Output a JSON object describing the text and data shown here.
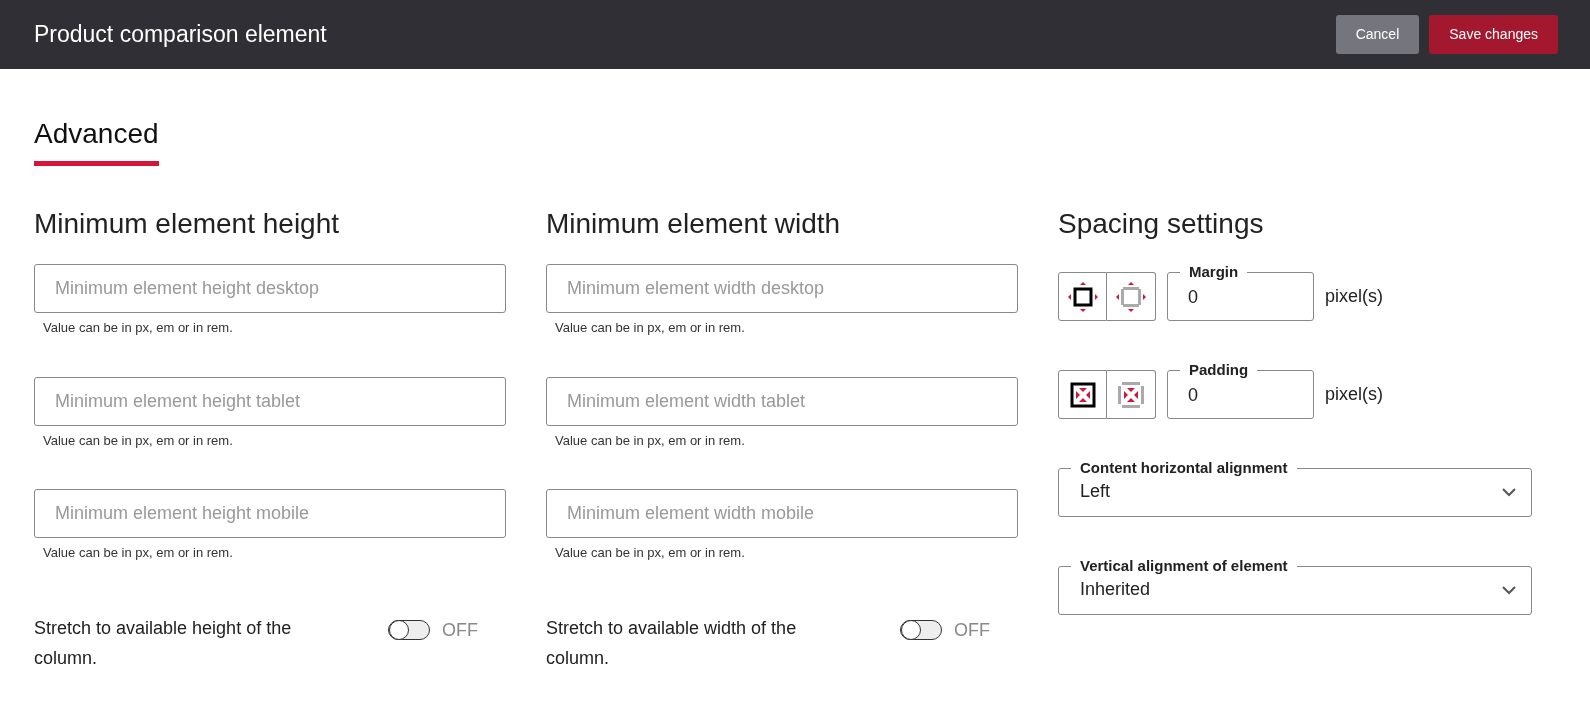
{
  "header": {
    "title": "Product comparison element",
    "buttons": [
      {
        "label": "Cancel",
        "kind": "secondary"
      },
      {
        "label": "Save changes",
        "kind": "primary"
      }
    ]
  },
  "tabs": [
    {
      "label": "Advanced",
      "selected": true
    }
  ],
  "columns": [
    {
      "heading": "Minimum element height",
      "fields": [
        {
          "placeholder": "Minimum element height desktop",
          "hint": "Value can be in px, em or in rem."
        },
        {
          "placeholder": "Minimum element height tablet",
          "hint": "Value can be in px, em or in rem."
        },
        {
          "placeholder": "Minimum element height mobile",
          "hint": "Value can be in px, em or in rem."
        }
      ],
      "toggle": {
        "label": "Stretch to available height of the column.",
        "on": false,
        "state_text": "OFF"
      }
    },
    {
      "heading": "Minimum element width",
      "fields": [
        {
          "placeholder": "Minimum element width desktop",
          "hint": "Value can be in px, em or in rem."
        },
        {
          "placeholder": "Minimum element width tablet",
          "hint": "Value can be in px, em or in rem."
        },
        {
          "placeholder": "Minimum element width mobile",
          "hint": "Value can be in px, em or in rem."
        }
      ],
      "toggle": {
        "label": "Stretch to available width of the column.",
        "on": false,
        "state_text": "OFF"
      }
    }
  ],
  "spacing": {
    "heading": "Spacing settings",
    "rows": [
      {
        "kind": "margin",
        "label": "Margin",
        "value": "0",
        "unit": "pixel(s)",
        "modes": [
          {
            "selected": true
          },
          {
            "selected": false
          }
        ]
      },
      {
        "kind": "padding",
        "label": "Padding",
        "value": "0",
        "unit": "pixel(s)",
        "modes": [
          {
            "selected": true
          },
          {
            "selected": false
          }
        ]
      }
    ],
    "selects": [
      {
        "label": "Content horizontal alignment",
        "value": "Left"
      },
      {
        "label": "Vertical alignment of element",
        "value": "Inherited"
      }
    ]
  }
}
